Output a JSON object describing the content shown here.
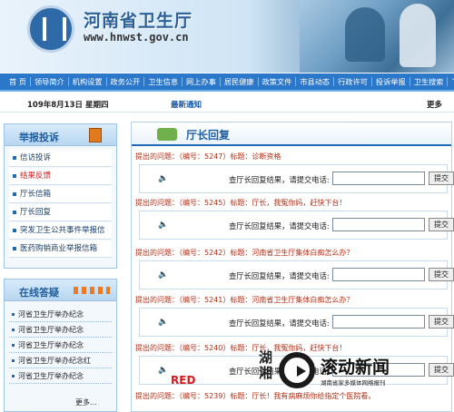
{
  "header": {
    "title": "河南省卫生厅",
    "url": "www.hnwst.gov.cn"
  },
  "nav": [
    "首  页",
    "领导简介",
    "机构设置",
    "政务公开",
    "卫生信息",
    "网上办事",
    "居民健康",
    "政策文件",
    "市县动态",
    "行政许可",
    "投诉举报",
    "卫生搜索",
    "下"
  ],
  "datebar": {
    "date": "109年8月13日 星期四",
    "latest": "最新通知",
    "more": "更多"
  },
  "sidebar": {
    "report_title": "举报投诉",
    "report_items": [
      {
        "label": "信访投诉",
        "active": false
      },
      {
        "label": "结果反馈",
        "active": true
      },
      {
        "label": "厅长信箱",
        "active": false
      },
      {
        "label": "厅长回复",
        "active": false
      },
      {
        "label": "突发卫生公共事件举报信箱",
        "active": false
      },
      {
        "label": "医药购销商业举报信箱",
        "active": false
      }
    ],
    "qa_title": "在线答疑",
    "qa_items": [
      "河省卫生厅举办纪念",
      "河省卫生厅举办纪念",
      "河省卫生厅举办纪念",
      "河省卫生厅举办纪念红",
      "河省卫生厅举办纪念"
    ],
    "qa_more": "更多..."
  },
  "content": {
    "title": "厅长回复",
    "reply_label": "查厅长回复结果，请提交电话:",
    "submit_label": "提交",
    "items": [
      {
        "question": "提出的问题：（编号：5247）标题：诊断资格"
      },
      {
        "question": "提出的问题：（编号：5245）标题：厅长，我冤你妈，赶快下台！"
      },
      {
        "question": "提出的问题：（编号：5242）标题：河南省卫生厅集体白痴怎么办？"
      },
      {
        "question": "提出的问题：（编号：5241）标题：河南省卫生厅集体白痴怎么办？"
      },
      {
        "question": "提出的问题：（编号：5240）标题：厅长，我冤你妈，赶快下台！"
      },
      {
        "question": "提出的问题：（编号：5239）标题：厅长！我有病麻烦你给指定个医院看。"
      }
    ]
  },
  "watermark": {
    "left_chars": "湖湘",
    "brand": "滚动新闻",
    "tagline": "湖南省家多媒体网络报刊"
  },
  "stamp": "RED"
}
